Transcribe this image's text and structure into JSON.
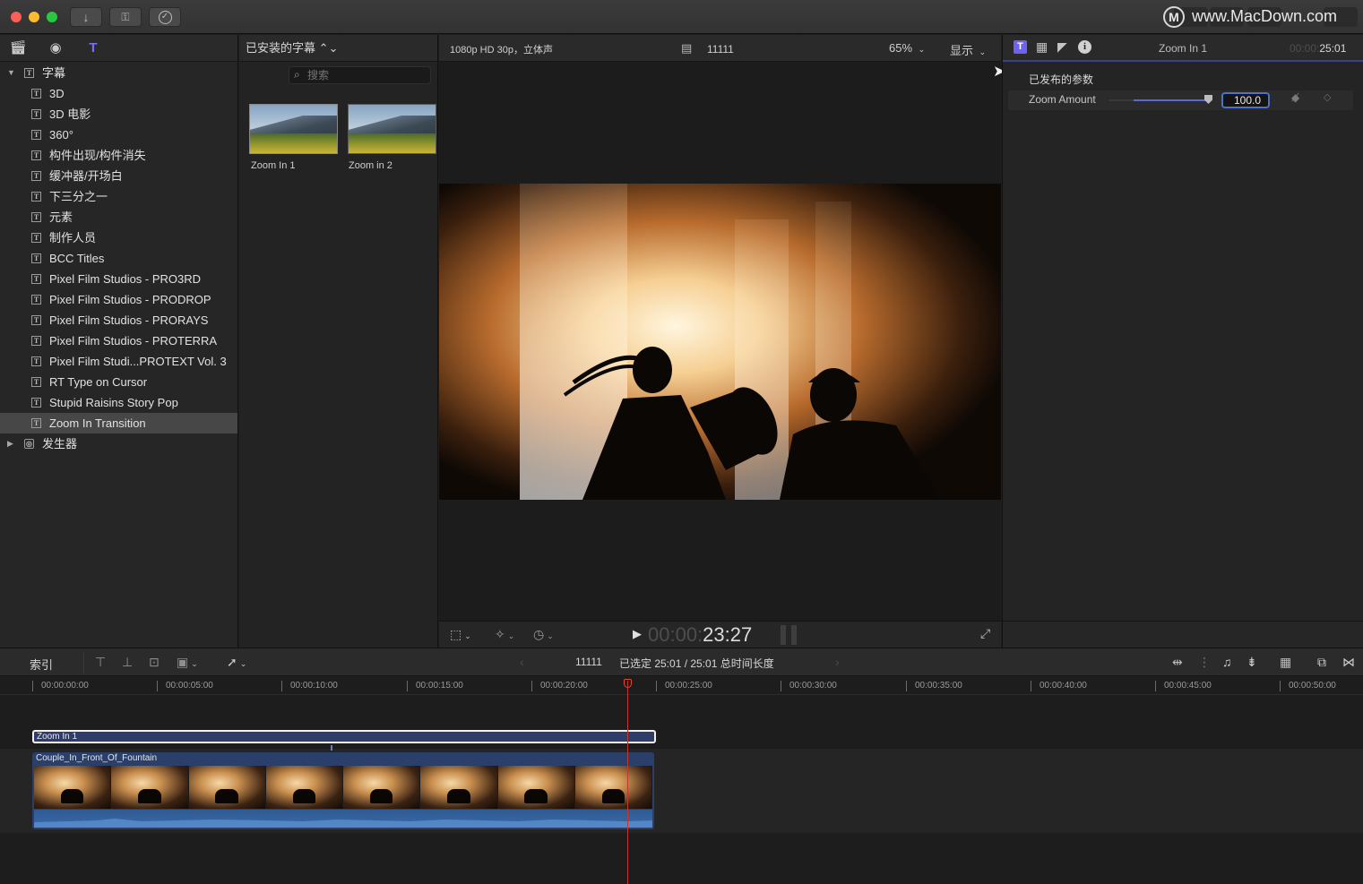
{
  "watermark": "www.MacDown.com",
  "toolbar": {
    "import_icon": "download-arrow-icon",
    "keyword_icon": "key-icon",
    "background_tasks_icon": "checkmark-circle-icon"
  },
  "sidebar": {
    "root": {
      "label": "字幕",
      "expanded": true
    },
    "items": [
      {
        "label": "3D"
      },
      {
        "label": "3D 电影"
      },
      {
        "label": "360°"
      },
      {
        "label": "构件出现/构件消失"
      },
      {
        "label": "缓冲器/开场白"
      },
      {
        "label": "下三分之一"
      },
      {
        "label": "元素"
      },
      {
        "label": "制作人员"
      },
      {
        "label": "BCC Titles"
      },
      {
        "label": "Pixel Film Studios - PRO3RD"
      },
      {
        "label": "Pixel Film Studios - PRODROP"
      },
      {
        "label": "Pixel Film Studios - PRORAYS"
      },
      {
        "label": "Pixel Film Studios - PROTERRA"
      },
      {
        "label": "Pixel Film Studi...PROTEXT Vol. 3"
      },
      {
        "label": "RT Type on Cursor"
      },
      {
        "label": "Stupid Raisins Story Pop"
      },
      {
        "label": "Zoom In Transition",
        "selected": true
      }
    ],
    "generators": {
      "label": "发生器",
      "expanded": false
    }
  },
  "browser": {
    "header": "已安装的字幕 ⌃⌄",
    "search_placeholder": "搜索",
    "thumbnails": [
      {
        "label": "Zoom In 1"
      },
      {
        "label": "Zoom in 2"
      }
    ]
  },
  "viewer": {
    "format": "1080p HD 30p，立体声",
    "project_name": "11111",
    "zoom": "65%",
    "display_menu": "显示",
    "timecode_dim": "00:00:",
    "timecode_bright": "23:27"
  },
  "inspector": {
    "title": "Zoom In 1",
    "timecode_dim": "00:00:",
    "timecode_bright": "25:01",
    "section": "已发布的参数",
    "param_label": "Zoom Amount",
    "param_value": "100.0",
    "param_slider_level": 1.0
  },
  "timeline_toolbar": {
    "index_label": "索引",
    "project_name": "11111",
    "selection_info": "已选定 25:01 / 25:01 总时间长度"
  },
  "timeline": {
    "ruler": [
      "00:00:00:00",
      "00:00:05:00",
      "00:00:10:00",
      "00:00:15:00",
      "00:00:20:00",
      "00:00:25:00",
      "00:00:30:00",
      "00:00:35:00",
      "00:00:40:00",
      "00:00:45:00",
      "00:00:50:00"
    ],
    "title_clip": "Zoom In 1",
    "video_clip": "Couple_In_Front_Of_Fountain",
    "playhead_time": "00:00:23:27"
  }
}
